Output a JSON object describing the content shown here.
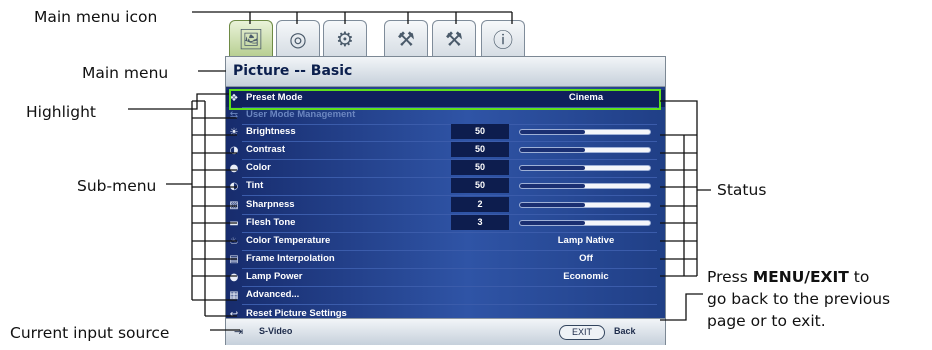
{
  "callouts": {
    "main_menu_icon": "Main menu icon",
    "main_menu": "Main menu",
    "highlight": "Highlight",
    "sub_menu": "Sub-menu",
    "status": "Status",
    "current_input_source": "Current input source",
    "press_exit_line1_pre": "Press ",
    "press_exit_line1_bold": "MENU/EXIT",
    "press_exit_line1_post": " to",
    "press_exit_line2": "go back to the previous",
    "press_exit_line3": "page or to exit."
  },
  "tabs": [
    {
      "icon": "picture-icon",
      "glyph": "🖼",
      "active": true
    },
    {
      "icon": "projector-lens-icon",
      "glyph": "◎",
      "active": false
    },
    {
      "icon": "settings-gear-icon",
      "glyph": "⚙",
      "active": false
    },
    {
      "icon": "wrench-icon",
      "glyph": "⚒",
      "active": false
    },
    {
      "icon": "advanced-wrench-icon",
      "glyph": "⚒",
      "active": false
    },
    {
      "icon": "information-icon",
      "glyph": "ⓘ",
      "active": false
    }
  ],
  "menu": {
    "title": "Picture -- Basic",
    "items": [
      {
        "icon": "preset-mode-icon",
        "glyph": "❖",
        "label": "Preset Mode",
        "value": "Cinema",
        "level": null,
        "dim": false
      },
      {
        "icon": "user-mode-icon",
        "glyph": "⇆",
        "label": "User Mode Management",
        "value": null,
        "level": null,
        "dim": true
      },
      {
        "icon": "brightness-icon",
        "glyph": "☀",
        "label": "Brightness",
        "number": "50",
        "level": 50,
        "dim": false
      },
      {
        "icon": "contrast-icon",
        "glyph": "◑",
        "label": "Contrast",
        "number": "50",
        "level": 50,
        "dim": false
      },
      {
        "icon": "color-icon",
        "glyph": "●",
        "label": "Color",
        "number": "50",
        "level": 50,
        "dim": false
      },
      {
        "icon": "tint-icon",
        "glyph": "◐",
        "label": "Tint",
        "number": "50",
        "level": 50,
        "dim": false
      },
      {
        "icon": "sharpness-icon",
        "glyph": "▨",
        "label": "Sharpness",
        "number": "2",
        "level": 50,
        "dim": false
      },
      {
        "icon": "flesh-tone-icon",
        "glyph": "▬",
        "label": "Flesh Tone",
        "number": "3",
        "level": 50,
        "dim": false
      },
      {
        "icon": "color-temperature-icon",
        "glyph": "♨",
        "label": "Color Temperature",
        "value": "Lamp Native",
        "level": null,
        "dim": false
      },
      {
        "icon": "frame-interpolation-icon",
        "glyph": "▤",
        "label": "Frame Interpolation",
        "value": "Off",
        "level": null,
        "dim": false
      },
      {
        "icon": "lamp-power-icon",
        "glyph": "●",
        "label": "Lamp Power",
        "value": "Economic",
        "level": null,
        "dim": false
      },
      {
        "icon": "advanced-icon",
        "glyph": "▦",
        "label": "Advanced...",
        "value": null,
        "level": null,
        "dim": false
      },
      {
        "icon": "reset-icon",
        "glyph": "↩",
        "label": "Reset Picture Settings",
        "value": null,
        "level": null,
        "dim": false
      }
    ]
  },
  "footer": {
    "source_icon": "input-source-icon",
    "source_glyph": "⇥",
    "source": "S-Video",
    "exit_label": "EXIT",
    "back_label": "Back"
  },
  "colors": {
    "highlight": "#5fe01c",
    "menu_body": "#2a4a9a",
    "active_tab": "#b8cf93"
  }
}
